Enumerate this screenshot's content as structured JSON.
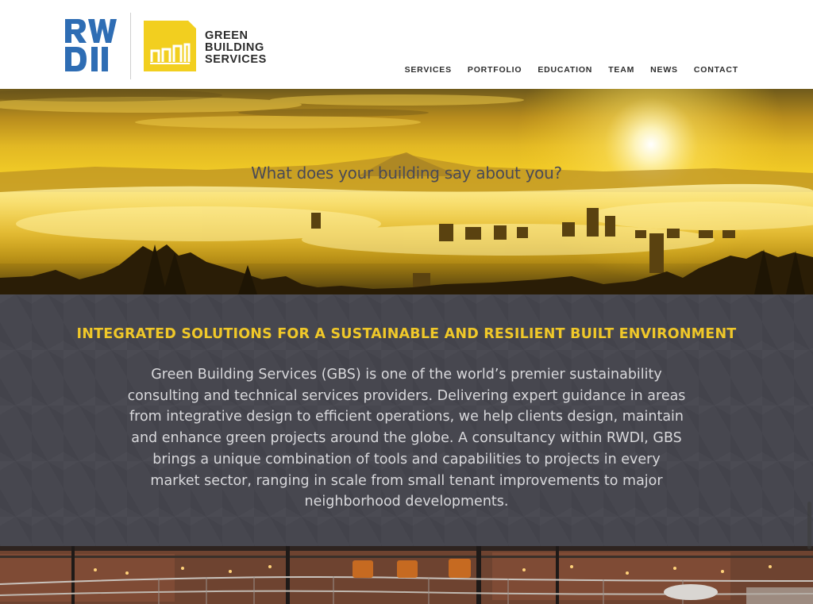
{
  "header": {
    "logo_rwdi_label": "RWDI",
    "logo_gbs_lines": [
      "GREEN",
      "BUILDING",
      "SERVICES"
    ],
    "nav": [
      {
        "label": "SERVICES"
      },
      {
        "label": "PORTFOLIO"
      },
      {
        "label": "EDUCATION"
      },
      {
        "label": "TEAM"
      },
      {
        "label": "NEWS"
      },
      {
        "label": "CONTACT"
      }
    ]
  },
  "hero": {
    "tagline": "What does your building say about you?"
  },
  "intro": {
    "heading": "INTEGRATED SOLUTIONS FOR A SUSTAINABLE AND RESILIENT BUILT ENVIRONMENT",
    "body": "Green Building Services (GBS) is one of the world’s premier sustainability consulting and technical services providers. Delivering expert guidance in areas from integrative design to efficient operations, we help clients design, maintain and enhance green projects around the globe. A consultancy within RWDI, GBS brings a unique combination of tools and capabilities to projects in every market sector, ranging in scale from small tenant improvements to major neighborhood developments."
  },
  "colors": {
    "rwdi_blue": "#2e6db4",
    "gbs_yellow": "#f2cf1f",
    "intro_bg": "#47474f",
    "heading_yellow": "#f0c829"
  },
  "icons": {
    "rwdi_logo": "rwdi-logo",
    "gbs_logo": "gbs-bars-logo"
  }
}
